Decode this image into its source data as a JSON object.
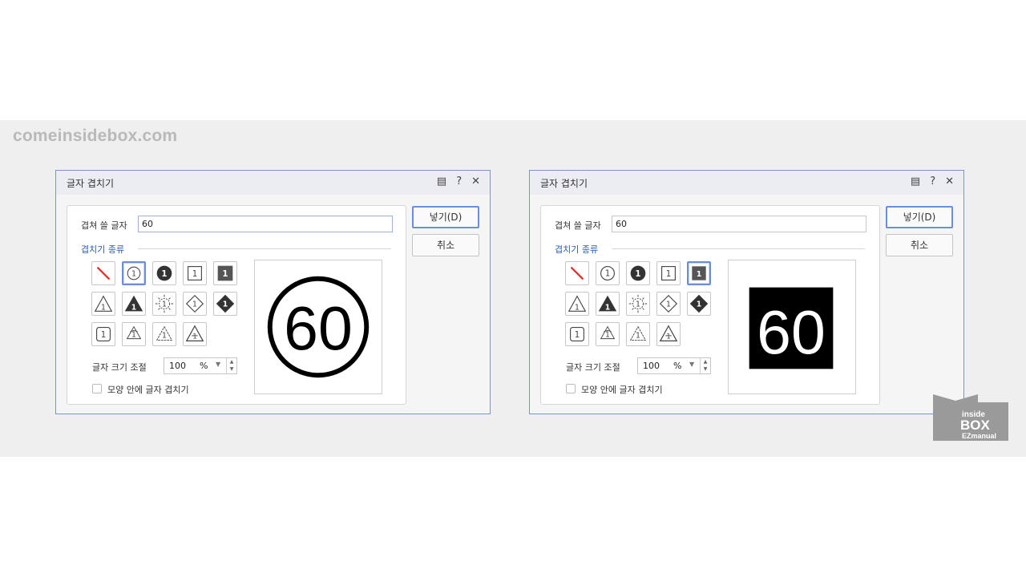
{
  "watermark": "comeinsidebox.com",
  "dialogs": [
    {
      "title": "글자 겹치기",
      "overlap_text_label": "겹쳐 쓸 글자",
      "overlap_text_value": "60",
      "shape_group_label": "겹치기 종류",
      "size_label": "글자 크기 조절",
      "size_value": "100",
      "size_unit": "%",
      "inside_shape_label": "모양 안에 글자 겹치기",
      "insert_button": "넣기(D)",
      "cancel_button": "취소",
      "selected_shape": "circle-outline",
      "preview_text": "60"
    },
    {
      "title": "글자 겹치기",
      "overlap_text_label": "겹쳐 쓸 글자",
      "overlap_text_value": "60",
      "shape_group_label": "겹치기 종류",
      "size_label": "글자 크기 조절",
      "size_value": "100",
      "size_unit": "%",
      "inside_shape_label": "모양 안에 글자 겹치기",
      "insert_button": "넣기(D)",
      "cancel_button": "취소",
      "selected_shape": "square-filled",
      "preview_text": "60"
    }
  ],
  "shape_tiles": [
    "none-icon",
    "circle-outline-icon",
    "circle-filled-icon",
    "square-outline-icon",
    "square-filled-icon",
    "triangle-outline-icon",
    "triangle-filled-icon",
    "sun-outline-icon",
    "diamond-outline-icon",
    "diamond-filled-icon",
    "rounded-square-icon",
    "recycle-icon-1",
    "recycle-icon-2",
    "recycle-icon-3"
  ],
  "logo": {
    "line1": "inside",
    "line2": "BOX",
    "line3": "EZmanual"
  }
}
